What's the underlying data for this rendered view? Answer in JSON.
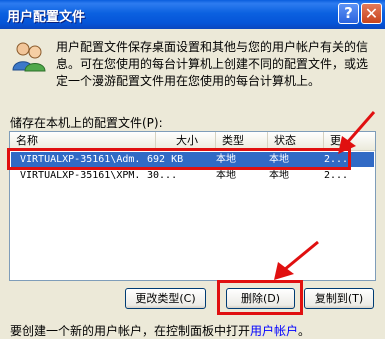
{
  "window": {
    "title": "用户配置文件",
    "help_glyph": "?",
    "close_glyph": "✕"
  },
  "intro_text": "用户配置文件保存桌面设置和其他与您的用户帐户有关的信息。可在您使用的每台计算机上创建不同的配置文件，或选定一个漫游配置文件用在您使用的每台计算机上。",
  "stored_label": "储存在本机上的配置文件(P):",
  "columns": [
    "名称",
    "大小",
    "类型",
    "状态",
    "更"
  ],
  "rows": [
    {
      "name": "VIRTUALXP-35161\\Adm...",
      "size": "692 KB",
      "type": "本地",
      "status": "本地",
      "mod": "2..."
    },
    {
      "name": "VIRTUALXP-35161\\XPM...",
      "size": "30...",
      "type": "本地",
      "status": "本地",
      "mod": "2..."
    }
  ],
  "buttons": {
    "change_type": "更改类型(C)",
    "delete": "删除(D)",
    "copy_to": "复制到(T)"
  },
  "footer": {
    "prefix": "要创建一个新的用户帐户，在控制面板中打开",
    "link": "用户帐户",
    "suffix": "。"
  },
  "colors": {
    "annotation": "#E01010",
    "selection": "#316AC5"
  },
  "icons": {
    "profile": "users-icon"
  }
}
